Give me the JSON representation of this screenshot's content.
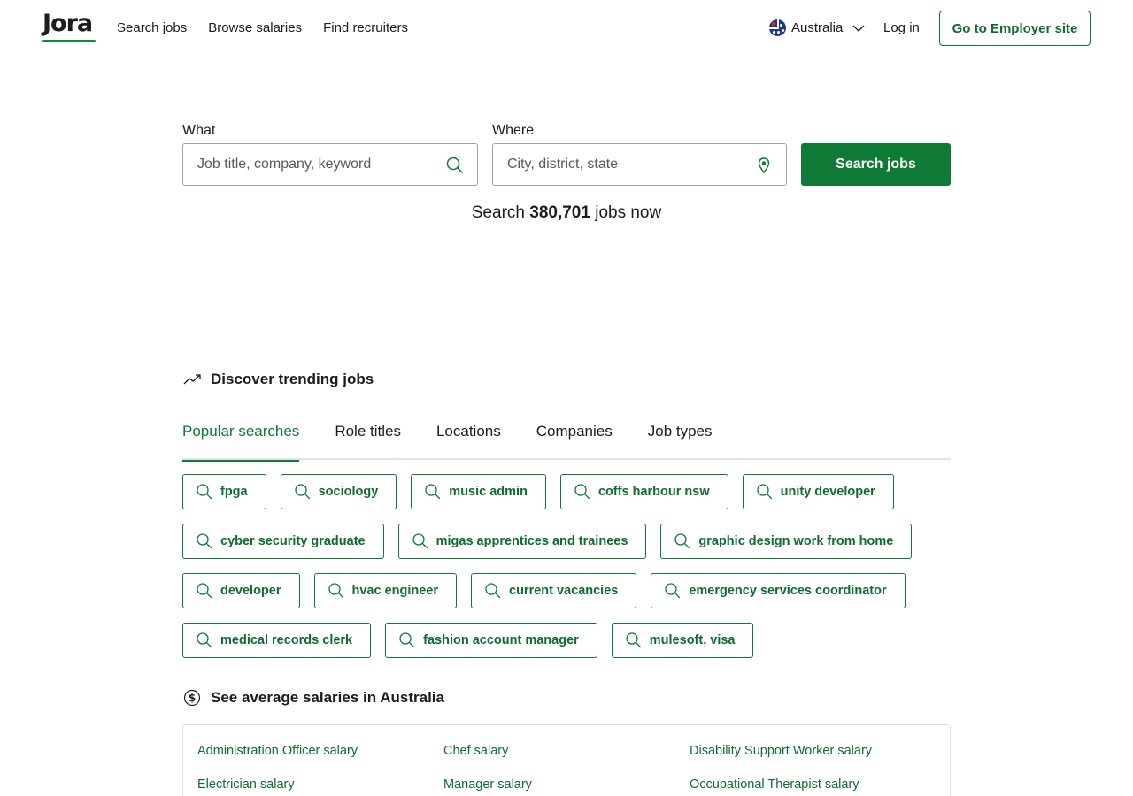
{
  "header": {
    "logo": "Jora",
    "nav": [
      "Search jobs",
      "Browse salaries",
      "Find recruiters"
    ],
    "country": "Australia",
    "login": "Log in",
    "employer_button": "Go to Employer site"
  },
  "search": {
    "what_label": "What",
    "what_placeholder": "Job title, company, keyword",
    "where_label": "Where",
    "where_placeholder": "City, district, state",
    "button": "Search jobs",
    "count_prefix": "Search",
    "count_value": "380,701",
    "count_suffix": "jobs now"
  },
  "trending": {
    "title": "Discover trending jobs",
    "tabs": [
      "Popular searches",
      "Role titles",
      "Locations",
      "Companies",
      "Job types"
    ],
    "active_tab": "Popular searches",
    "chips": [
      "fpga",
      "sociology",
      "music admin",
      "coffs harbour nsw",
      "unity developer",
      "cyber security graduate",
      "migas apprentices and trainees",
      "graphic design work from home",
      "developer",
      "hvac engineer",
      "current vacancies",
      "emergency services coordinator",
      "medical records clerk",
      "fashion account manager",
      "mulesoft, visa"
    ]
  },
  "salaries": {
    "title": "See average salaries in Australia",
    "links": [
      "Administration Officer salary",
      "Chef salary",
      "Disability Support Worker salary",
      "Electrician salary",
      "Manager salary",
      "Occupational Therapist salary"
    ]
  },
  "colors": {
    "brand_green": "#0f7a35",
    "text": "#1c1c1c",
    "border": "#a3a3a3"
  }
}
